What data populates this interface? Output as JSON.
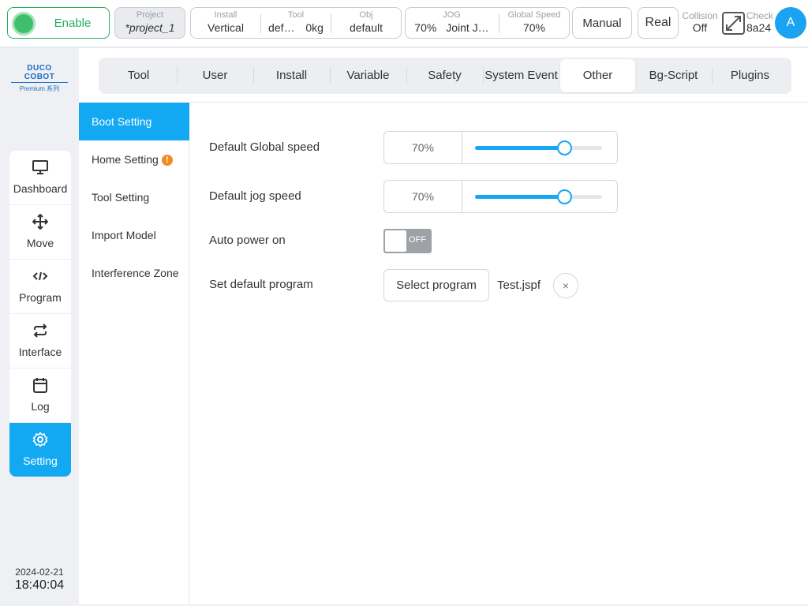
{
  "topbar": {
    "enable": {
      "label": "Enable"
    },
    "project": {
      "caption": "Project",
      "value": "*project_1"
    },
    "install": {
      "caption": "Install",
      "value": "Vertical"
    },
    "tool": {
      "caption": "Tool",
      "name": "def…",
      "load": "0kg"
    },
    "obj": {
      "caption": "Obj",
      "value": "default"
    },
    "jog": {
      "caption": "JOG",
      "speed": "70%",
      "mode": "Joint J…"
    },
    "global_speed": {
      "caption": "Global Speed",
      "value": "70%"
    },
    "mode_button": "Manual",
    "real_button": "Real",
    "collision": {
      "caption": "Collision",
      "value": "Off"
    },
    "check": {
      "caption": "Check",
      "value": "8a24"
    },
    "avatar": "A"
  },
  "logo": {
    "line1": "DUCO COBOT",
    "line2": "Premium 系列"
  },
  "nav": [
    {
      "label": "Dashboard",
      "icon": "monitor-icon"
    },
    {
      "label": "Move",
      "icon": "move-arrows-icon"
    },
    {
      "label": "Program",
      "icon": "code-icon"
    },
    {
      "label": "Interface",
      "icon": "repeat-arrows-icon"
    },
    {
      "label": "Log",
      "icon": "calendar-icon"
    },
    {
      "label": "Setting",
      "icon": "gear-icon",
      "active": true
    }
  ],
  "datetime": {
    "date": "2024-02-21",
    "time": "18:40:04"
  },
  "tabs": [
    "Tool",
    "User",
    "Install",
    "Variable",
    "Safety",
    "System Event",
    "Other",
    "Bg-Script",
    "Plugins"
  ],
  "active_tab": "Other",
  "side_menu": [
    "Boot Setting",
    "Home Setting",
    "Tool Setting",
    "Import Model",
    "Interference Zone"
  ],
  "active_side_menu": "Boot Setting",
  "warning_icon": "!",
  "settings": {
    "global_speed": {
      "label": "Default Global speed",
      "value": "70%",
      "percent": 70
    },
    "jog_speed": {
      "label": "Default jog speed",
      "value": "70%",
      "percent": 70
    },
    "auto_power": {
      "label": "Auto power on",
      "state": "OFF"
    },
    "default_program": {
      "label": "Set default program",
      "button": "Select program",
      "file": "Test.jspf",
      "clear": "×"
    }
  },
  "colors": {
    "accent": "#12a8f2",
    "enable_green": "#27ae60",
    "warning": "#f28c1c",
    "toggle_off": "#9ea1a6"
  }
}
